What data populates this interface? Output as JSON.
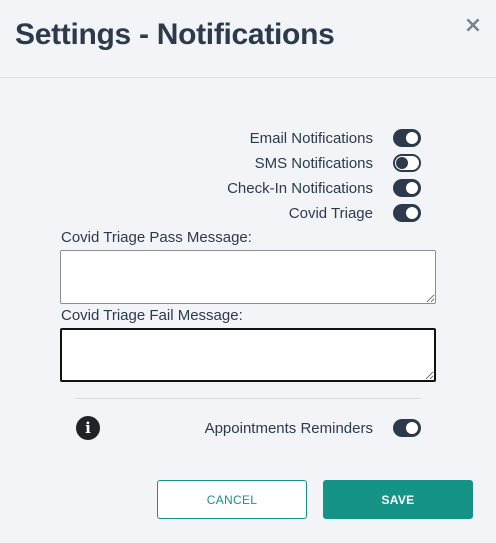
{
  "dialog": {
    "title": "Settings - Notifications",
    "close_label": "×"
  },
  "toggles": [
    {
      "label": "Email Notifications",
      "on": true
    },
    {
      "label": "SMS Notifications",
      "on": false
    },
    {
      "label": "Check-In Notifications",
      "on": true
    },
    {
      "label": "Covid Triage",
      "on": true
    }
  ],
  "fields": {
    "pass_message": {
      "label": "Covid Triage Pass Message:",
      "value": ""
    },
    "fail_message": {
      "label": "Covid Triage Fail Message:",
      "value": ""
    }
  },
  "reminders": {
    "info_glyph": "i",
    "label": "Appointments Reminders",
    "on": true
  },
  "buttons": {
    "cancel_label": "CANCEL",
    "save_label": "SAVE"
  },
  "colors": {
    "accent": "#149386",
    "toggle": "#2c3a4b",
    "title": "#2c3a4b"
  }
}
